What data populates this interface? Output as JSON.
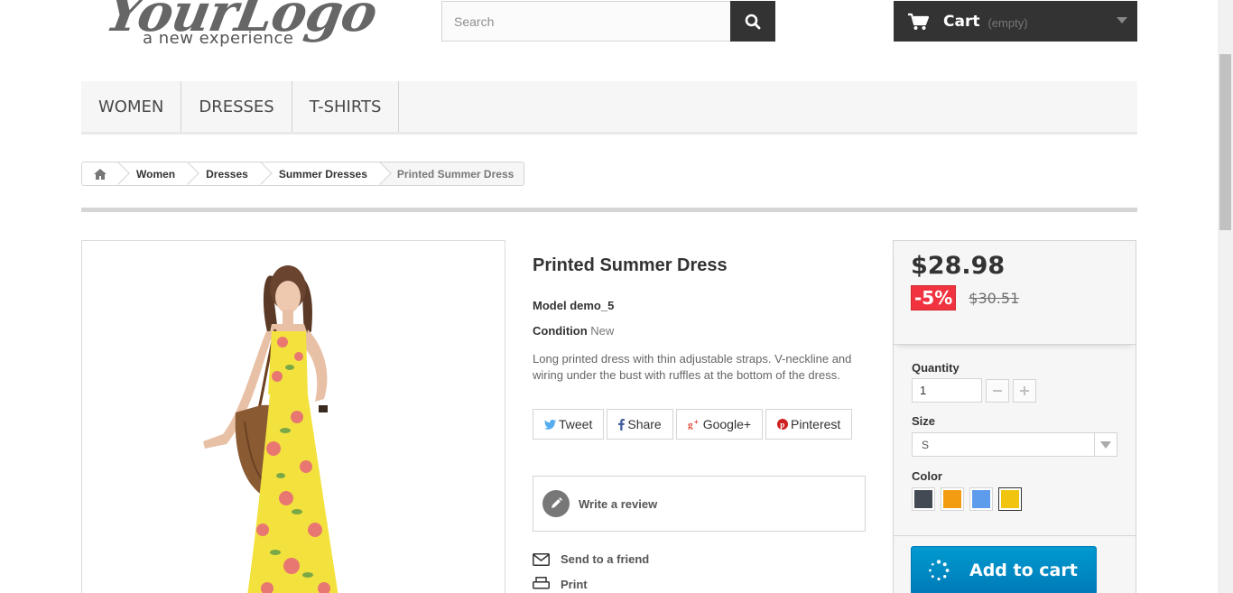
{
  "header": {
    "logo_main": "YourLogo",
    "logo_sub": "a new experience",
    "search_placeholder": "Search",
    "cart_label": "Cart",
    "cart_status": "(empty)"
  },
  "menu": {
    "items": [
      {
        "label": "WOMEN"
      },
      {
        "label": "DRESSES"
      },
      {
        "label": "T-SHIRTS"
      }
    ]
  },
  "breadcrumb": {
    "items": [
      "Women",
      "Dresses",
      "Summer Dresses"
    ],
    "current": "Printed Summer Dress"
  },
  "product": {
    "title": "Printed Summer Dress",
    "model_label": "Model",
    "model_value": "demo_5",
    "condition_label": "Condition",
    "condition_value": "New",
    "description": "Long printed dress with thin adjustable straps. V-neckline and wiring under the bust with ruffles at the bottom of the dress.",
    "share": {
      "tweet": "Tweet",
      "share": "Share",
      "google": "Google+",
      "pinterest": "Pinterest"
    },
    "write_review": "Write a review",
    "send_friend": "Send to a friend",
    "print": "Print"
  },
  "buy": {
    "price": "$28.98",
    "discount": "-5%",
    "old_price": "$30.51",
    "quantity_label": "Quantity",
    "quantity_value": "1",
    "size_label": "Size",
    "size_value": "S",
    "color_label": "Color",
    "colors": [
      "#434A54",
      "#F39C11",
      "#5D9CEC",
      "#F1C40F"
    ],
    "selected_color_index": 3,
    "add_to_cart": "Add to cart"
  }
}
